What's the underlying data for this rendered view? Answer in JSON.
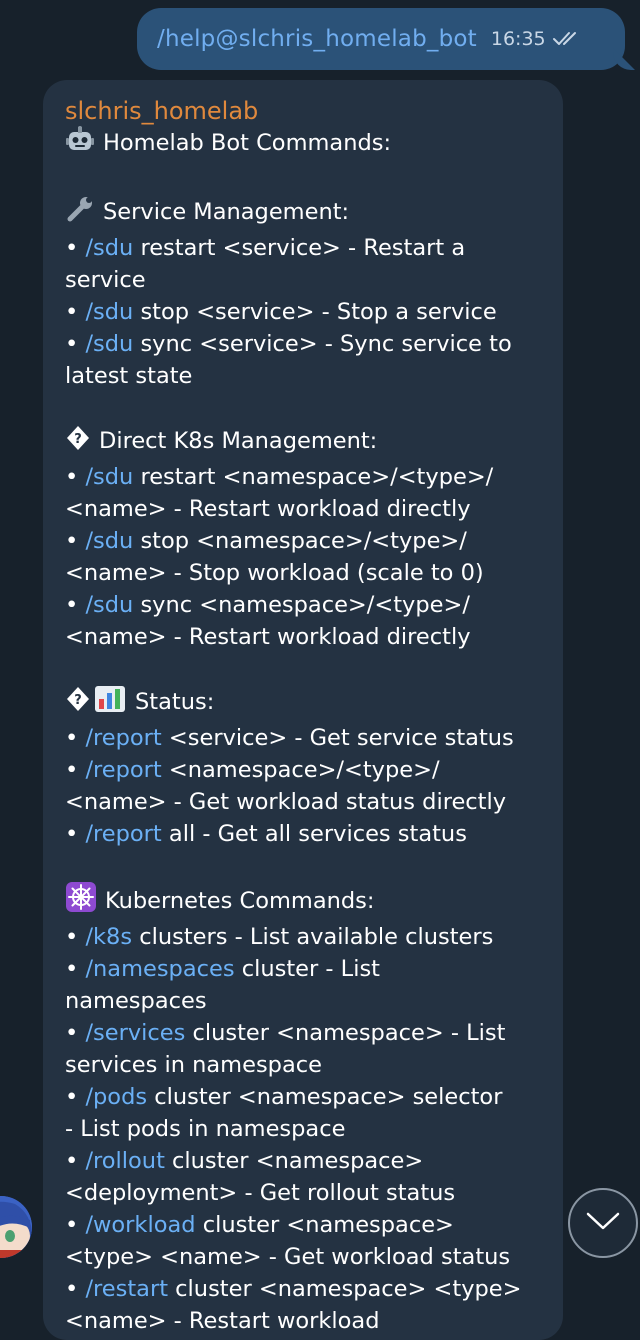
{
  "outgoing": {
    "text": "/help@slchris_homelab_bot",
    "time": "16:35",
    "status_icon": "double-check-icon"
  },
  "incoming": {
    "sender": "slchris_homelab",
    "lines": [
      {
        "emoji": "robot",
        "parts": [
          {
            "t": "Homelab Bot Commands:"
          }
        ]
      },
      {
        "parts": []
      },
      {
        "emoji": "wrench",
        "parts": [
          {
            "t": "Service Management:"
          }
        ]
      },
      {
        "parts": [
          {
            "t": "• "
          },
          {
            "t": "/sdu",
            "c": 1
          },
          {
            "t": " restart <service> - Restart a"
          }
        ]
      },
      {
        "parts": [
          {
            "t": "service"
          }
        ]
      },
      {
        "parts": [
          {
            "t": "• "
          },
          {
            "t": "/sdu",
            "c": 1
          },
          {
            "t": " stop <service> - Stop a service"
          }
        ]
      },
      {
        "parts": [
          {
            "t": "• "
          },
          {
            "t": "/sdu",
            "c": 1
          },
          {
            "t": " sync <service> - Sync service to"
          }
        ]
      },
      {
        "parts": [
          {
            "t": "latest state"
          }
        ]
      },
      {
        "parts": []
      },
      {
        "emoji": "unknown",
        "parts": [
          {
            "t": "Direct K8s Management:"
          }
        ]
      },
      {
        "parts": [
          {
            "t": "• "
          },
          {
            "t": "/sdu",
            "c": 1
          },
          {
            "t": " restart <namespace>/<type>/"
          }
        ]
      },
      {
        "parts": [
          {
            "t": "<name> - Restart workload directly"
          }
        ]
      },
      {
        "parts": [
          {
            "t": "• "
          },
          {
            "t": "/sdu",
            "c": 1
          },
          {
            "t": " stop <namespace>/<type>/"
          }
        ]
      },
      {
        "parts": [
          {
            "t": "<name> - Stop workload (scale to 0)"
          }
        ]
      },
      {
        "parts": [
          {
            "t": "• "
          },
          {
            "t": "/sdu",
            "c": 1
          },
          {
            "t": " sync <namespace>/<type>/"
          }
        ]
      },
      {
        "parts": [
          {
            "t": "<name> - Restart workload directly"
          }
        ]
      },
      {
        "parts": []
      },
      {
        "emoji": "unknown-chart",
        "parts": [
          {
            "t": "Status:"
          }
        ]
      },
      {
        "parts": [
          {
            "t": "• "
          },
          {
            "t": "/report",
            "c": 1
          },
          {
            "t": " <service> - Get service status"
          }
        ]
      },
      {
        "parts": [
          {
            "t": "• "
          },
          {
            "t": "/report",
            "c": 1
          },
          {
            "t": " <namespace>/<type>/"
          }
        ]
      },
      {
        "parts": [
          {
            "t": "<name> - Get workload status directly"
          }
        ]
      },
      {
        "parts": [
          {
            "t": "• "
          },
          {
            "t": "/report",
            "c": 1
          },
          {
            "t": " all - Get all services status"
          }
        ]
      },
      {
        "parts": []
      },
      {
        "emoji": "helm",
        "parts": [
          {
            "t": "Kubernetes Commands:"
          }
        ]
      },
      {
        "parts": [
          {
            "t": "• "
          },
          {
            "t": "/k8s",
            "c": 1
          },
          {
            "t": " clusters - List available clusters"
          }
        ]
      },
      {
        "parts": [
          {
            "t": "• "
          },
          {
            "t": "/namespaces",
            "c": 1
          },
          {
            "t": " cluster - List"
          }
        ]
      },
      {
        "parts": [
          {
            "t": "namespaces"
          }
        ]
      },
      {
        "parts": [
          {
            "t": "• "
          },
          {
            "t": "/services",
            "c": 1
          },
          {
            "t": " cluster <namespace> - List"
          }
        ]
      },
      {
        "parts": [
          {
            "t": "services in namespace"
          }
        ]
      },
      {
        "parts": [
          {
            "t": "• "
          },
          {
            "t": "/pods",
            "c": 1
          },
          {
            "t": " cluster <namespace> selector"
          }
        ]
      },
      {
        "parts": [
          {
            "t": "- List pods in namespace"
          }
        ]
      },
      {
        "parts": [
          {
            "t": "• "
          },
          {
            "t": "/rollout",
            "c": 1
          },
          {
            "t": " cluster <namespace>"
          }
        ]
      },
      {
        "parts": [
          {
            "t": "<deployment> - Get rollout status"
          }
        ]
      },
      {
        "parts": [
          {
            "t": "• "
          },
          {
            "t": "/workload",
            "c": 1
          },
          {
            "t": " cluster <namespace>"
          }
        ]
      },
      {
        "parts": [
          {
            "t": "<type> <name> - Get workload status"
          }
        ]
      },
      {
        "parts": [
          {
            "t": "• "
          },
          {
            "t": "/restart",
            "c": 1
          },
          {
            "t": " cluster <namespace> <type>"
          }
        ]
      },
      {
        "parts": [
          {
            "t": "<name> - Restart workload"
          }
        ]
      }
    ]
  },
  "scroll_down_icon": "chevron-down-icon",
  "avatar_icon": "avatar",
  "colors": {
    "background": "#17212b",
    "outgoing_bubble": "#2b5278",
    "incoming_bubble": "#243242",
    "sender_name": "#e0893d",
    "command_link": "#6bb0f5"
  }
}
